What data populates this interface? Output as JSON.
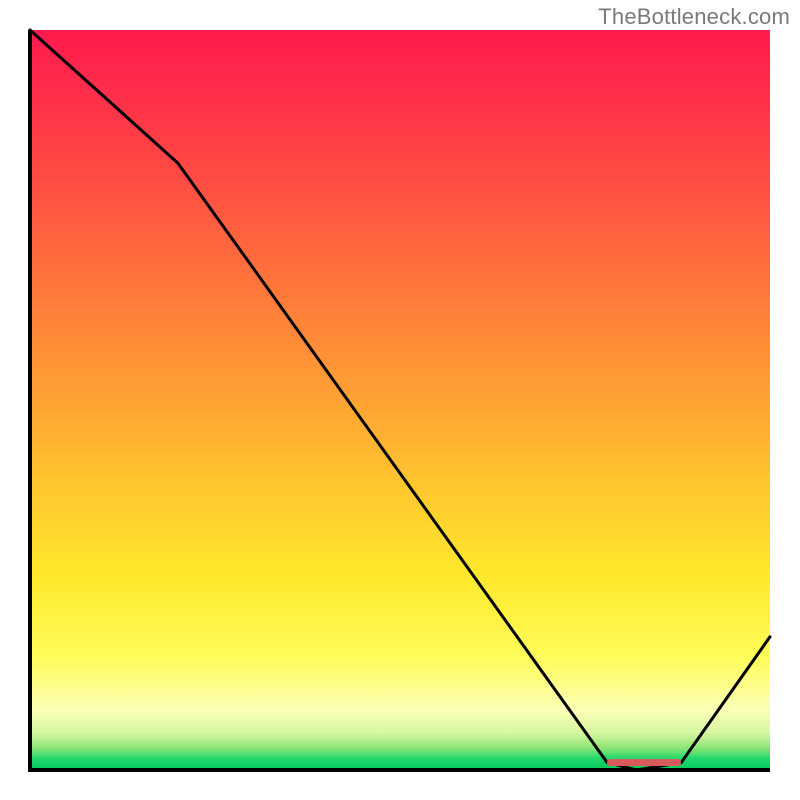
{
  "attribution": "TheBottleneck.com",
  "chart_data": {
    "type": "line",
    "title": "",
    "xlabel": "",
    "ylabel": "",
    "xlim": [
      0,
      100
    ],
    "ylim": [
      0,
      100
    ],
    "x": [
      0,
      20,
      78,
      82,
      88,
      100
    ],
    "values": [
      100,
      82,
      1,
      0,
      1,
      18
    ],
    "optimal_range_x": [
      78,
      88
    ],
    "gradient_stops": [
      {
        "pos": 0.0,
        "color": "#ff1a4d"
      },
      {
        "pos": 0.5,
        "color": "#ffa233"
      },
      {
        "pos": 0.85,
        "color": "#fffd5c"
      },
      {
        "pos": 1.0,
        "color": "#00c85f"
      }
    ]
  }
}
